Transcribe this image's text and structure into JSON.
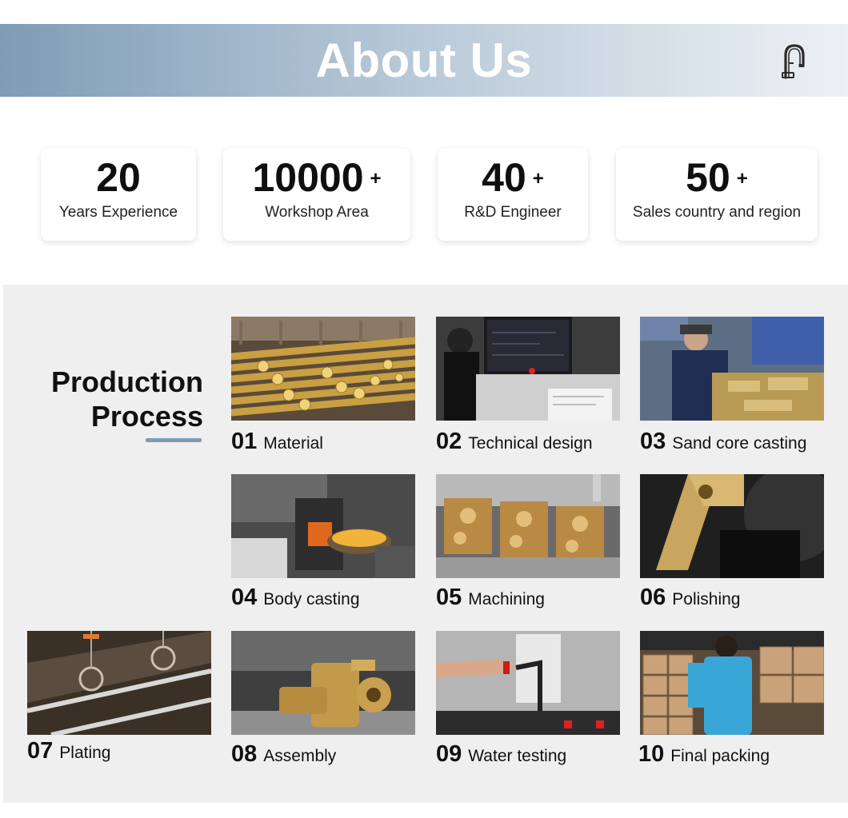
{
  "banner": {
    "title": "About Us",
    "icon": "faucet-icon"
  },
  "stats": [
    {
      "value": "20",
      "suffix": "",
      "label": "Years Experience"
    },
    {
      "value": "10000",
      "suffix": "+",
      "label": "Workshop Area"
    },
    {
      "value": "40",
      "suffix": "+",
      "label": "R&D Engineer"
    },
    {
      "value": "50",
      "suffix": "+",
      "label": "Sales country and region"
    }
  ],
  "production": {
    "title_line1": "Production",
    "title_line2": "Process",
    "accent_color": "#7f9cb6",
    "steps": [
      {
        "num": "01",
        "label": "Material"
      },
      {
        "num": "02",
        "label": "Technical design"
      },
      {
        "num": "03",
        "label": "Sand core casting"
      },
      {
        "num": "04",
        "label": "Body casting"
      },
      {
        "num": "05",
        "label": "Machining"
      },
      {
        "num": "06",
        "label": "Polishing"
      },
      {
        "num": "07",
        "label": "Plating"
      },
      {
        "num": "08",
        "label": "Assembly"
      },
      {
        "num": "09",
        "label": "Water testing"
      },
      {
        "num": "10",
        "label": "Final packing"
      }
    ]
  }
}
